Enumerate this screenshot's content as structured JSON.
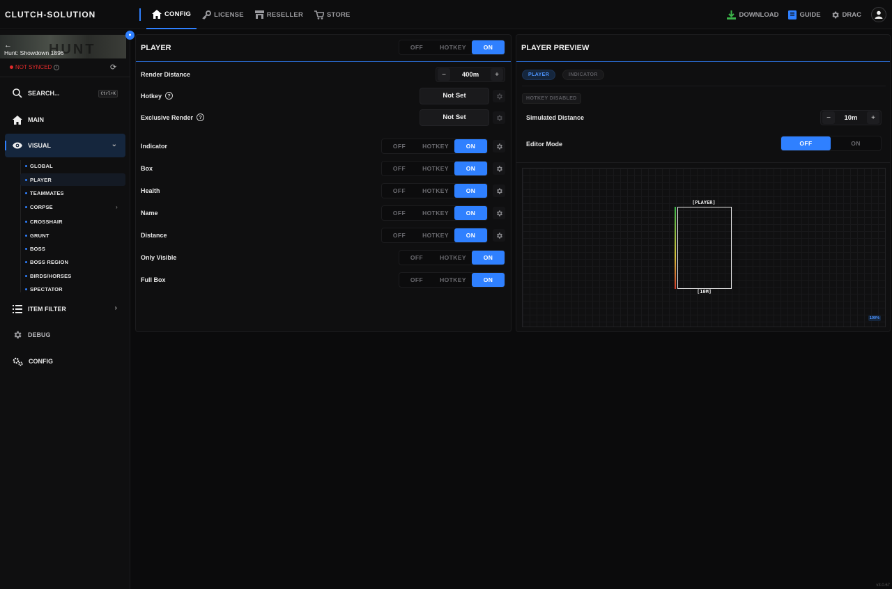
{
  "app": {
    "brand": "CLUTCH-SOLUTION",
    "version": "v3.0.67"
  },
  "topnav": {
    "tabs": [
      {
        "label": "CONFIG",
        "icon": "home-icon",
        "active": true
      },
      {
        "label": "LICENSE",
        "icon": "key-icon"
      },
      {
        "label": "RESELLER",
        "icon": "store-icon"
      },
      {
        "label": "STORE",
        "icon": "cart-icon"
      }
    ],
    "right": {
      "download": "DOWNLOAD",
      "guide": "GUIDE",
      "user": "DRAC"
    }
  },
  "sidebar": {
    "game": "Hunt: Showdown 1896",
    "banner_word": "HUNT",
    "sync_status": "NOT SYNCED",
    "search": {
      "label": "SEARCH...",
      "shortcut": "Ctrl+K"
    },
    "main": "MAIN",
    "visual": "VISUAL",
    "subitems": [
      "GLOBAL",
      "PLAYER",
      "TEAMMATES",
      "CORPSE",
      "CROSSHAIR",
      "GRUNT",
      "BOSS",
      "BOSS REGION",
      "BIRDS/HORSES",
      "SPECTATOR"
    ],
    "item_filter": "ITEM FILTER",
    "debug": "DEBUG",
    "config": "CONFIG"
  },
  "player_panel": {
    "title": "PLAYER",
    "mode": {
      "off": "OFF",
      "hotkey": "HOTKEY",
      "on": "ON",
      "selected": "ON"
    },
    "render_distance": {
      "label": "Render Distance",
      "value": "400m"
    },
    "hotkey": {
      "label": "Hotkey",
      "value": "Not Set"
    },
    "exclusive_render": {
      "label": "Exclusive Render",
      "value": "Not Set"
    },
    "rows": [
      {
        "label": "Indicator",
        "value": "ON",
        "gear": true
      },
      {
        "label": "Box",
        "value": "ON",
        "gear": true
      },
      {
        "label": "Health",
        "value": "ON",
        "gear": true
      },
      {
        "label": "Name",
        "value": "ON",
        "gear": true
      },
      {
        "label": "Distance",
        "value": "ON",
        "gear": true
      },
      {
        "label": "Only Visible",
        "value": "ON",
        "gear": false
      },
      {
        "label": "Full Box",
        "value": "ON",
        "gear": false
      }
    ],
    "seg": {
      "off": "OFF",
      "hotkey": "HOTKEY",
      "on": "ON"
    }
  },
  "preview_panel": {
    "title": "PLAYER PREVIEW",
    "tabs": {
      "player": "PLAYER",
      "indicator": "INDICATOR"
    },
    "hotkey_badge": "HOTKEY DISABLED",
    "simulated_distance": {
      "label": "Simulated Distance",
      "value": "10m"
    },
    "editor_mode": {
      "label": "Editor Mode",
      "off": "OFF",
      "on": "ON",
      "selected": "OFF"
    },
    "canvas": {
      "name_tag": "[PLAYER]",
      "distance_tag": "[10M]",
      "zoom": "100%",
      "health_percent": 100
    }
  },
  "colors": {
    "accent": "#2f80ff",
    "error": "#e02b2b",
    "health_high": "#39b54a",
    "health_low": "#d23a2a"
  }
}
